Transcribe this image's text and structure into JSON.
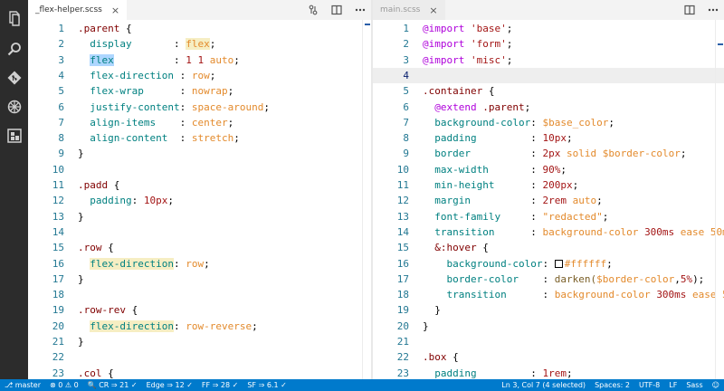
{
  "activity_bar": {
    "icons": [
      "files-icon",
      "search-icon",
      "git-icon",
      "debug-icon",
      "extensions-icon"
    ]
  },
  "left_editor": {
    "tab_label": "_flex-helper.scss",
    "lines": [
      {
        "n": "1",
        "tokens": [
          {
            "t": ".parent",
            "c": "sel"
          },
          {
            "t": " {",
            "c": "punc"
          }
        ]
      },
      {
        "n": "2",
        "tokens": [
          {
            "t": "  ",
            "c": "guide"
          },
          {
            "t": "display",
            "c": "prop"
          },
          {
            "t": "       : ",
            "c": "punc"
          },
          {
            "t": "flex",
            "c": "val hl2"
          },
          {
            "t": ";",
            "c": "punc"
          }
        ]
      },
      {
        "n": "3",
        "tokens": [
          {
            "t": "  ",
            "c": "guide"
          },
          {
            "t": "flex",
            "c": "prop hl"
          },
          {
            "t": "          : ",
            "c": "punc"
          },
          {
            "t": "1 1 ",
            "c": "num"
          },
          {
            "t": "auto",
            "c": "val"
          },
          {
            "t": ";",
            "c": "punc"
          }
        ]
      },
      {
        "n": "4",
        "tokens": [
          {
            "t": "  ",
            "c": "guide"
          },
          {
            "t": "flex-direction",
            "c": "prop"
          },
          {
            "t": " : ",
            "c": "punc"
          },
          {
            "t": "row",
            "c": "val"
          },
          {
            "t": ";",
            "c": "punc"
          }
        ]
      },
      {
        "n": "5",
        "tokens": [
          {
            "t": "  ",
            "c": "guide"
          },
          {
            "t": "flex-wrap",
            "c": "prop"
          },
          {
            "t": "      : ",
            "c": "punc"
          },
          {
            "t": "nowrap",
            "c": "val"
          },
          {
            "t": ";",
            "c": "punc"
          }
        ]
      },
      {
        "n": "6",
        "tokens": [
          {
            "t": "  ",
            "c": "guide"
          },
          {
            "t": "justify-content",
            "c": "prop"
          },
          {
            "t": ": ",
            "c": "punc"
          },
          {
            "t": "space-around",
            "c": "val"
          },
          {
            "t": ";",
            "c": "punc"
          }
        ]
      },
      {
        "n": "7",
        "tokens": [
          {
            "t": "  ",
            "c": "guide"
          },
          {
            "t": "align-items",
            "c": "prop"
          },
          {
            "t": "    : ",
            "c": "punc"
          },
          {
            "t": "center",
            "c": "val"
          },
          {
            "t": ";",
            "c": "punc"
          }
        ]
      },
      {
        "n": "8",
        "tokens": [
          {
            "t": "  ",
            "c": "guide"
          },
          {
            "t": "align-content",
            "c": "prop"
          },
          {
            "t": "  : ",
            "c": "punc"
          },
          {
            "t": "stretch",
            "c": "val"
          },
          {
            "t": ";",
            "c": "punc"
          }
        ]
      },
      {
        "n": "9",
        "tokens": [
          {
            "t": "}",
            "c": "punc"
          }
        ]
      },
      {
        "n": "10",
        "tokens": []
      },
      {
        "n": "11",
        "tokens": [
          {
            "t": ".padd",
            "c": "sel"
          },
          {
            "t": " {",
            "c": "punc"
          }
        ]
      },
      {
        "n": "12",
        "tokens": [
          {
            "t": "  ",
            "c": "guide"
          },
          {
            "t": "padding",
            "c": "prop"
          },
          {
            "t": ": ",
            "c": "punc"
          },
          {
            "t": "10px",
            "c": "num"
          },
          {
            "t": ";",
            "c": "punc"
          }
        ]
      },
      {
        "n": "13",
        "tokens": [
          {
            "t": "}",
            "c": "punc"
          }
        ]
      },
      {
        "n": "14",
        "tokens": []
      },
      {
        "n": "15",
        "tokens": [
          {
            "t": ".row",
            "c": "sel"
          },
          {
            "t": " {",
            "c": "punc"
          }
        ]
      },
      {
        "n": "16",
        "tokens": [
          {
            "t": "  ",
            "c": "guide"
          },
          {
            "t": "flex-direction",
            "c": "prop hl2"
          },
          {
            "t": ": ",
            "c": "punc"
          },
          {
            "t": "row",
            "c": "val"
          },
          {
            "t": ";",
            "c": "punc"
          }
        ]
      },
      {
        "n": "17",
        "tokens": [
          {
            "t": "}",
            "c": "punc"
          }
        ]
      },
      {
        "n": "18",
        "tokens": []
      },
      {
        "n": "19",
        "tokens": [
          {
            "t": ".row-rev",
            "c": "sel"
          },
          {
            "t": " {",
            "c": "punc"
          }
        ]
      },
      {
        "n": "20",
        "tokens": [
          {
            "t": "  ",
            "c": "guide"
          },
          {
            "t": "flex-direction",
            "c": "prop hl2"
          },
          {
            "t": ": ",
            "c": "punc"
          },
          {
            "t": "row-reverse",
            "c": "val"
          },
          {
            "t": ";",
            "c": "punc"
          }
        ]
      },
      {
        "n": "21",
        "tokens": [
          {
            "t": "}",
            "c": "punc"
          }
        ]
      },
      {
        "n": "22",
        "tokens": []
      },
      {
        "n": "23",
        "tokens": [
          {
            "t": ".col",
            "c": "sel"
          },
          {
            "t": " {",
            "c": "punc"
          }
        ]
      }
    ]
  },
  "right_editor": {
    "tab_label": "main.scss",
    "lines": [
      {
        "n": "1",
        "tokens": [
          {
            "t": "@import",
            "c": "kw"
          },
          {
            "t": " ",
            "c": "punc"
          },
          {
            "t": "'base'",
            "c": "str"
          },
          {
            "t": ";",
            "c": "punc"
          }
        ]
      },
      {
        "n": "2",
        "tokens": [
          {
            "t": "@import",
            "c": "kw"
          },
          {
            "t": " ",
            "c": "punc"
          },
          {
            "t": "'form'",
            "c": "str"
          },
          {
            "t": ";",
            "c": "punc"
          }
        ]
      },
      {
        "n": "3",
        "tokens": [
          {
            "t": "@import",
            "c": "kw"
          },
          {
            "t": " ",
            "c": "punc"
          },
          {
            "t": "'misc'",
            "c": "str"
          },
          {
            "t": ";",
            "c": "punc"
          }
        ]
      },
      {
        "n": "4",
        "tokens": []
      },
      {
        "n": "5",
        "tokens": [
          {
            "t": ".container",
            "c": "sel"
          },
          {
            "t": " {",
            "c": "punc"
          }
        ]
      },
      {
        "n": "6",
        "tokens": [
          {
            "t": "  ",
            "c": "guide"
          },
          {
            "t": "@extend",
            "c": "kw"
          },
          {
            "t": " ",
            "c": "punc"
          },
          {
            "t": ".parent",
            "c": "sel"
          },
          {
            "t": ";",
            "c": "punc"
          }
        ]
      },
      {
        "n": "7",
        "tokens": [
          {
            "t": "  ",
            "c": "guide"
          },
          {
            "t": "background-color",
            "c": "prop"
          },
          {
            "t": ": ",
            "c": "punc"
          },
          {
            "t": "$base_color",
            "c": "var"
          },
          {
            "t": ";",
            "c": "punc"
          }
        ]
      },
      {
        "n": "8",
        "tokens": [
          {
            "t": "  ",
            "c": "guide"
          },
          {
            "t": "padding",
            "c": "prop"
          },
          {
            "t": "         : ",
            "c": "punc"
          },
          {
            "t": "10px",
            "c": "num"
          },
          {
            "t": ";",
            "c": "punc"
          }
        ]
      },
      {
        "n": "9",
        "tokens": [
          {
            "t": "  ",
            "c": "guide"
          },
          {
            "t": "border",
            "c": "prop"
          },
          {
            "t": "          : ",
            "c": "punc"
          },
          {
            "t": "2px ",
            "c": "num"
          },
          {
            "t": "solid ",
            "c": "val"
          },
          {
            "t": "$border-color",
            "c": "var"
          },
          {
            "t": ";",
            "c": "punc"
          }
        ]
      },
      {
        "n": "10",
        "tokens": [
          {
            "t": "  ",
            "c": "guide"
          },
          {
            "t": "max-width",
            "c": "prop"
          },
          {
            "t": "       : ",
            "c": "punc"
          },
          {
            "t": "90%",
            "c": "num"
          },
          {
            "t": ";",
            "c": "punc"
          }
        ]
      },
      {
        "n": "11",
        "tokens": [
          {
            "t": "  ",
            "c": "guide"
          },
          {
            "t": "min-height",
            "c": "prop"
          },
          {
            "t": "      : ",
            "c": "punc"
          },
          {
            "t": "200px",
            "c": "num"
          },
          {
            "t": ";",
            "c": "punc"
          }
        ]
      },
      {
        "n": "12",
        "tokens": [
          {
            "t": "  ",
            "c": "guide"
          },
          {
            "t": "margin",
            "c": "prop"
          },
          {
            "t": "          : ",
            "c": "punc"
          },
          {
            "t": "2rem ",
            "c": "num"
          },
          {
            "t": "auto",
            "c": "val"
          },
          {
            "t": ";",
            "c": "punc"
          }
        ]
      },
      {
        "n": "13",
        "tokens": [
          {
            "t": "  ",
            "c": "guide"
          },
          {
            "t": "font-family",
            "c": "prop"
          },
          {
            "t": "     : ",
            "c": "punc"
          },
          {
            "t": "\"redacted\"",
            "c": "val"
          },
          {
            "t": ";",
            "c": "punc"
          }
        ]
      },
      {
        "n": "14",
        "tokens": [
          {
            "t": "  ",
            "c": "guide"
          },
          {
            "t": "transition",
            "c": "prop"
          },
          {
            "t": "      : ",
            "c": "punc"
          },
          {
            "t": "background-color ",
            "c": "val"
          },
          {
            "t": "300ms",
            "c": "num"
          },
          {
            "t": " ease 50m",
            "c": "val"
          }
        ]
      },
      {
        "n": "15",
        "tokens": [
          {
            "t": "  ",
            "c": "guide"
          },
          {
            "t": "&:hover",
            "c": "sel"
          },
          {
            "t": " {",
            "c": "punc"
          }
        ]
      },
      {
        "n": "16",
        "tokens": [
          {
            "t": "    ",
            "c": "guide"
          },
          {
            "t": "background-color",
            "c": "prop"
          },
          {
            "t": ": ",
            "c": "punc"
          },
          {
            "t": "#ffffff",
            "c": "val",
            "swatch": true
          },
          {
            "t": ";",
            "c": "punc"
          }
        ]
      },
      {
        "n": "17",
        "tokens": [
          {
            "t": "    ",
            "c": "guide"
          },
          {
            "t": "border-color",
            "c": "prop"
          },
          {
            "t": "    : ",
            "c": "punc"
          },
          {
            "t": "darken(",
            "c": "fn"
          },
          {
            "t": "$border-color",
            "c": "var"
          },
          {
            "t": ",",
            "c": "punc"
          },
          {
            "t": "5%",
            "c": "num"
          },
          {
            "t": ");",
            "c": "punc"
          }
        ]
      },
      {
        "n": "18",
        "tokens": [
          {
            "t": "    ",
            "c": "guide"
          },
          {
            "t": "transition",
            "c": "prop"
          },
          {
            "t": "      : ",
            "c": "punc"
          },
          {
            "t": "background-color ",
            "c": "val"
          },
          {
            "t": "300ms",
            "c": "num"
          },
          {
            "t": " ease 5",
            "c": "val"
          }
        ]
      },
      {
        "n": "19",
        "tokens": [
          {
            "t": "  ",
            "c": "guide"
          },
          {
            "t": "}",
            "c": "punc"
          }
        ]
      },
      {
        "n": "20",
        "tokens": [
          {
            "t": "}",
            "c": "punc"
          }
        ]
      },
      {
        "n": "21",
        "tokens": []
      },
      {
        "n": "22",
        "tokens": [
          {
            "t": ".box",
            "c": "sel"
          },
          {
            "t": " {",
            "c": "punc"
          }
        ]
      },
      {
        "n": "23",
        "tokens": [
          {
            "t": "  ",
            "c": "guide"
          },
          {
            "t": "padding",
            "c": "prop"
          },
          {
            "t": "         : ",
            "c": "punc"
          },
          {
            "t": "1rem",
            "c": "num"
          },
          {
            "t": ";",
            "c": "punc"
          }
        ]
      }
    ]
  },
  "statusbar": {
    "branch": "master",
    "errors": "0",
    "warnings": "0",
    "cr": "CR ⇒ 21 ✓",
    "edge": "Edge ⇒ 12 ✓",
    "ff": "FF ⇒ 28 ✓",
    "sf": "SF ⇒ 6.1 ✓",
    "cursor": "Ln 3, Col 7 (4 selected)",
    "spaces": "Spaces: 2",
    "encoding": "UTF-8",
    "eol": "LF",
    "language": "Sass"
  },
  "colors": {
    "activity_bar": "#2c2c2c",
    "statusbar": "#007acc",
    "line_number": "#237893",
    "selector": "#800000",
    "property": "#008080",
    "value": "#e38a2c",
    "number": "#a31515",
    "keyword": "#af00db"
  }
}
